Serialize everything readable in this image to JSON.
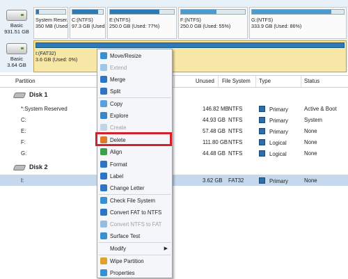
{
  "disk_map": {
    "disk1": {
      "name": "Basic",
      "size": "931.51 GB",
      "partitions": [
        {
          "name": "System Reser...",
          "info": "350 MB (Used:",
          "fill": 0.1
        },
        {
          "name": "C:(NTFS)",
          "info": "97.3 GB (Used:",
          "fill": 0.85
        },
        {
          "name": "E:(NTFS)",
          "info": "250.0 GB (Used: 77%)",
          "fill": 0.77
        },
        {
          "name": "F:(NTFS)",
          "info": "250.0 GB (Used: 55%)",
          "fill": 0.55
        },
        {
          "name": "G:(NTFS)",
          "info": "333.9 GB (Used: 86%)",
          "fill": 0.86
        }
      ]
    },
    "disk2": {
      "name": "Basic",
      "size": "3.64 GB",
      "partition": {
        "name": "I:(FAT32)",
        "info": "3.6 GB (Used: 0%)"
      }
    }
  },
  "columns": {
    "partition": "Partition",
    "unused": "Unused",
    "file_system": "File System",
    "type": "Type",
    "status": "Status"
  },
  "groups": {
    "disk1": "Disk 1",
    "disk2": "Disk 2"
  },
  "rows": [
    {
      "partition": "*:System Reserved",
      "unused": "146.82 MB",
      "fs": "NTFS",
      "type": "Primary",
      "status": "Active & Boot"
    },
    {
      "partition": "C:",
      "unused": "44.93 GB",
      "fs": "NTFS",
      "type": "Primary",
      "status": "System"
    },
    {
      "partition": "E:",
      "unused": "57.48 GB",
      "fs": "NTFS",
      "type": "Primary",
      "status": "None"
    },
    {
      "partition": "F:",
      "unused": "111.80 GB",
      "fs": "NTFS",
      "type": "Logical",
      "status": "None"
    },
    {
      "partition": "G:",
      "unused": "44.48 GB",
      "fs": "NTFS",
      "type": "Logical",
      "status": "None"
    },
    {
      "partition": "I:",
      "unused": "3.62 GB",
      "fs": "FAT32",
      "type": "Primary",
      "status": "None"
    }
  ],
  "menu": {
    "items": [
      {
        "label": "Move/Resize",
        "icon": "move-resize-icon",
        "enabled": true
      },
      {
        "label": "Extend",
        "icon": "extend-icon",
        "enabled": false
      },
      {
        "label": "Merge",
        "icon": "merge-icon",
        "enabled": true
      },
      {
        "label": "Split",
        "icon": "split-icon",
        "enabled": true
      },
      {
        "label": "Copy",
        "icon": "copy-icon",
        "enabled": true
      },
      {
        "label": "Explore",
        "icon": "explore-icon",
        "enabled": true
      },
      {
        "label": "Create",
        "icon": "create-icon",
        "enabled": false
      },
      {
        "label": "Delete",
        "icon": "delete-icon",
        "enabled": true
      },
      {
        "label": "Align",
        "icon": "align-icon",
        "enabled": true
      },
      {
        "label": "Format",
        "icon": "format-icon",
        "enabled": true
      },
      {
        "label": "Label",
        "icon": "label-icon",
        "enabled": true
      },
      {
        "label": "Change Letter",
        "icon": "change-letter-icon",
        "enabled": true
      },
      {
        "label": "Check File System",
        "icon": "check-file-system-icon",
        "enabled": true
      },
      {
        "label": "Convert FAT to NTFS",
        "icon": "convert-fat-ntfs-icon",
        "enabled": true
      },
      {
        "label": "Convert NTFS to FAT",
        "icon": "convert-ntfs-fat-icon",
        "enabled": false
      },
      {
        "label": "Surface Test",
        "icon": "surface-test-icon",
        "enabled": true
      },
      {
        "label": "Modify",
        "icon": "",
        "enabled": true,
        "submenu": true
      },
      {
        "label": "Wipe Partition",
        "icon": "wipe-partition-icon",
        "enabled": true
      },
      {
        "label": "Properties",
        "icon": "properties-icon",
        "enabled": true
      }
    ],
    "highlighted": "Delete"
  },
  "colors": {
    "primary_partition": "#2e79b6",
    "selected_row": "#c5d8ec",
    "highlight_box": "#d0222a"
  }
}
